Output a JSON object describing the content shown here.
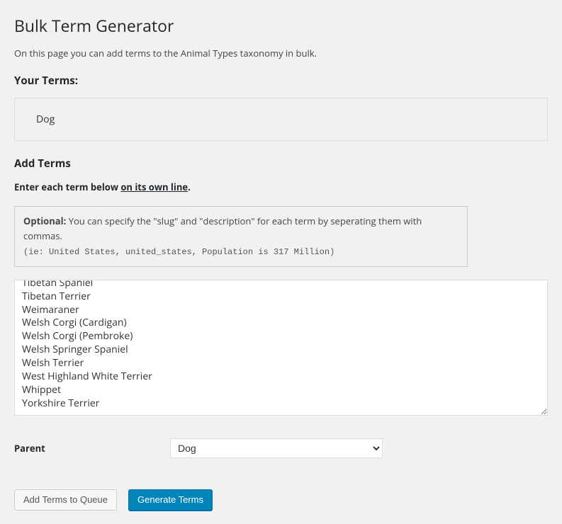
{
  "page": {
    "title": "Bulk Term Generator",
    "description": "On this page you can add terms to the Animal Types taxonomy in bulk."
  },
  "your_terms": {
    "heading": "Your Terms:",
    "items": [
      "Dog"
    ]
  },
  "add_terms": {
    "heading": "Add Terms",
    "instruction_prefix": "Enter each term below ",
    "instruction_underline": "on its own line",
    "instruction_suffix": "."
  },
  "optional_box": {
    "label": "Optional:",
    "text": " You can specify the \"slug\" and \"description\" for each term by seperating them with commas.",
    "example": "(ie: United States, united_states, Population is 317 Million)"
  },
  "textarea_value": "Tibetan Spaniel\nTibetan Terrier\nWeimaraner\nWelsh Corgi (Cardigan)\nWelsh Corgi (Pembroke)\nWelsh Springer Spaniel\nWelsh Terrier\nWest Highland White Terrier\nWhippet\nYorkshire Terrier",
  "parent": {
    "label": "Parent",
    "selected": "Dog",
    "options": [
      "Dog"
    ]
  },
  "buttons": {
    "add_queue": "Add Terms to Queue",
    "generate": "Generate Terms"
  }
}
